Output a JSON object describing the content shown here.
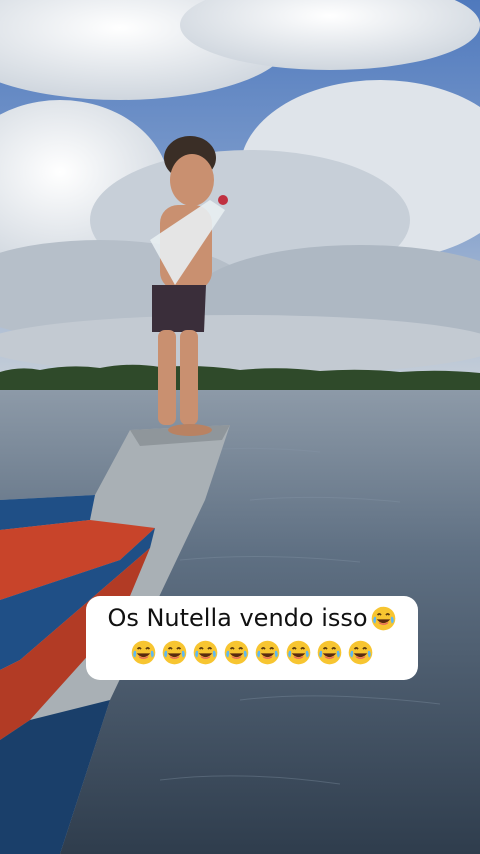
{
  "caption": {
    "text": "Os Nutella vendo isso",
    "emoji_icon": "face-with-tears-of-joy-icon",
    "emoji_row_count": 8
  },
  "colors": {
    "sky": "#5f86c4",
    "cloud": "#e9edf2",
    "river": "#56677a",
    "boat_blue": "#1f4f86",
    "boat_red": "#c8442a",
    "boat_gray": "#a7aeb3",
    "caption_bg": "#ffffff"
  }
}
